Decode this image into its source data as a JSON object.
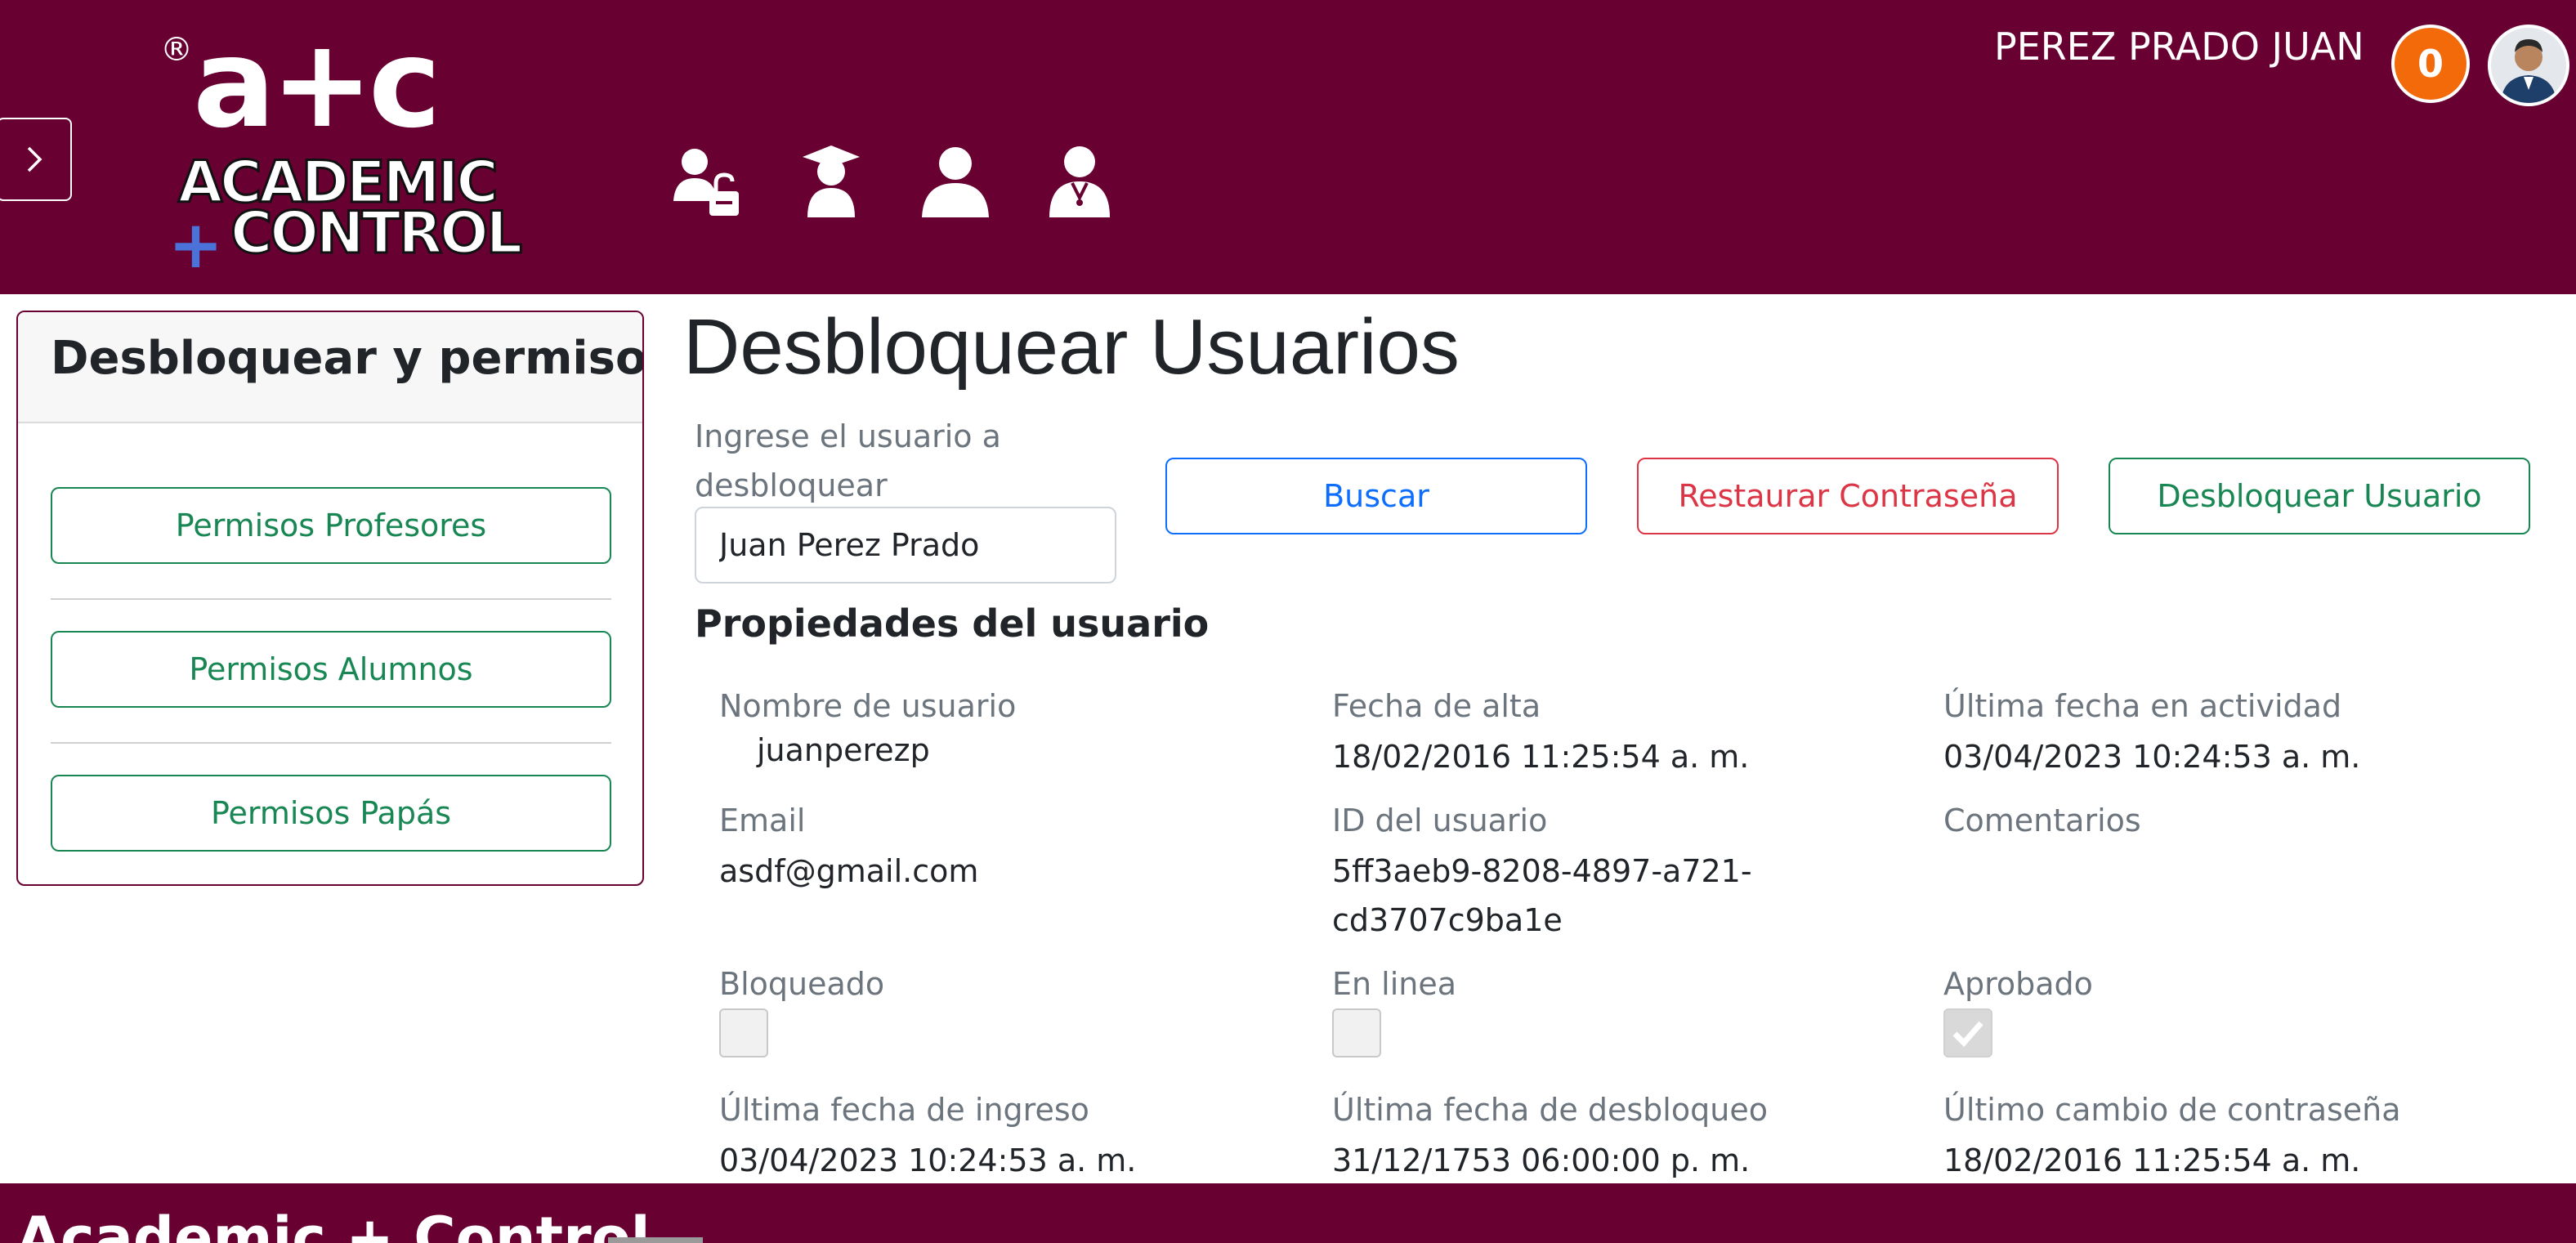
{
  "header": {
    "logo": {
      "registered": "®",
      "ac": "a+c",
      "line1": "ACADEMIC",
      "line2": "CONTROL"
    },
    "nav_icons": [
      "unlock-user-icon",
      "student-icon",
      "parent-icon",
      "teacher-icon"
    ],
    "user_name": "PEREZ PRADO JUAN",
    "notification_count": "0",
    "accent_color": "#680032"
  },
  "sidebar": {
    "title": "Desbloquear y permisos",
    "items": [
      {
        "label": "Permisos Profesores"
      },
      {
        "label": "Permisos Alumnos"
      },
      {
        "label": "Permisos Papás"
      }
    ]
  },
  "main": {
    "title": "Desbloquear Usuarios",
    "search": {
      "label": "Ingrese el usuario a desbloquear",
      "value": "Juan Perez Prado"
    },
    "buttons": {
      "buscar": "Buscar",
      "restaurar": "Restaurar Contraseña",
      "desbloquear": "Desbloquear Usuario"
    },
    "properties_title": "Propiedades del usuario",
    "properties": {
      "username": {
        "label": "Nombre de usuario",
        "value": "juanperezp"
      },
      "created": {
        "label": "Fecha de alta",
        "value": "18/02/2016 11:25:54 a. m."
      },
      "last_activity": {
        "label": "Última fecha en actividad",
        "value": "03/04/2023 10:24:53 a. m."
      },
      "email": {
        "label": "Email",
        "value": "asdf@gmail.com"
      },
      "user_id": {
        "label": "ID del usuario",
        "value_line1": "5ff3aeb9-8208-4897-a721-",
        "value_line2": "cd3707c9ba1e"
      },
      "comments": {
        "label": "Comentarios",
        "value": ""
      },
      "locked": {
        "label": "Bloqueado",
        "checked": false
      },
      "online": {
        "label": "En linea",
        "checked": false
      },
      "approved": {
        "label": "Aprobado",
        "checked": true
      },
      "last_login": {
        "label": "Última fecha de ingreso",
        "value": "03/04/2023 10:24:53 a. m."
      },
      "last_unlock": {
        "label": "Última fecha de desbloqueo",
        "value": "31/12/1753 06:00:00 p. m."
      },
      "last_password_change": {
        "label": "Último cambio de contraseña",
        "value": "18/02/2016 11:25:54 a. m."
      }
    }
  },
  "footer": {
    "brand": "Academic + Control"
  }
}
